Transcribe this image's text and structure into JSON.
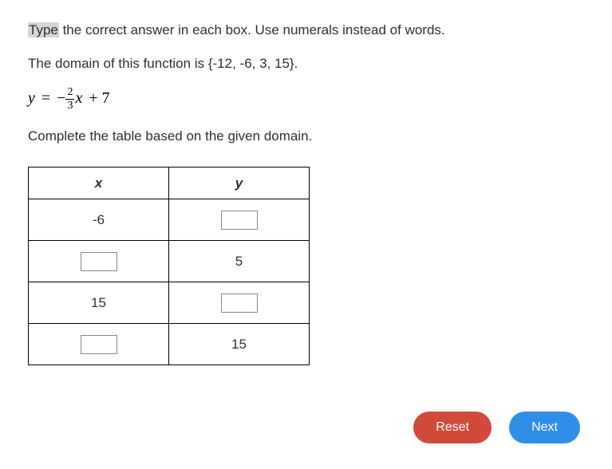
{
  "instruction": {
    "highlighted": "Type",
    "rest": " the correct answer in each box. Use numerals instead of words."
  },
  "domain_text": "The domain of this function is {-12, -6, 3, 15}.",
  "equation": {
    "lhs": "y",
    "eq": "=",
    "neg": "−",
    "frac_num": "2",
    "frac_den": "3",
    "var": "x",
    "plus": "+ 7"
  },
  "complete_text": "Complete the table based on the given domain.",
  "table": {
    "headers": {
      "x": "x",
      "y": "y"
    },
    "rows": [
      {
        "x_value": "-6",
        "x_input": false,
        "y_value": "",
        "y_input": true
      },
      {
        "x_value": "",
        "x_input": true,
        "y_value": "5",
        "y_input": false
      },
      {
        "x_value": "15",
        "x_input": false,
        "y_value": "",
        "y_input": true
      },
      {
        "x_value": "",
        "x_input": true,
        "y_value": "15",
        "y_input": false
      }
    ]
  },
  "buttons": {
    "reset": "Reset",
    "next": "Next"
  },
  "chart_data": {
    "type": "table",
    "function": "y = -(2/3)x + 7",
    "domain": [
      -12,
      -6,
      3,
      15
    ],
    "columns": [
      "x",
      "y"
    ],
    "rows_shown": [
      {
        "x": -6,
        "y": null
      },
      {
        "x": null,
        "y": 5
      },
      {
        "x": 15,
        "y": null
      },
      {
        "x": null,
        "y": 15
      }
    ]
  }
}
